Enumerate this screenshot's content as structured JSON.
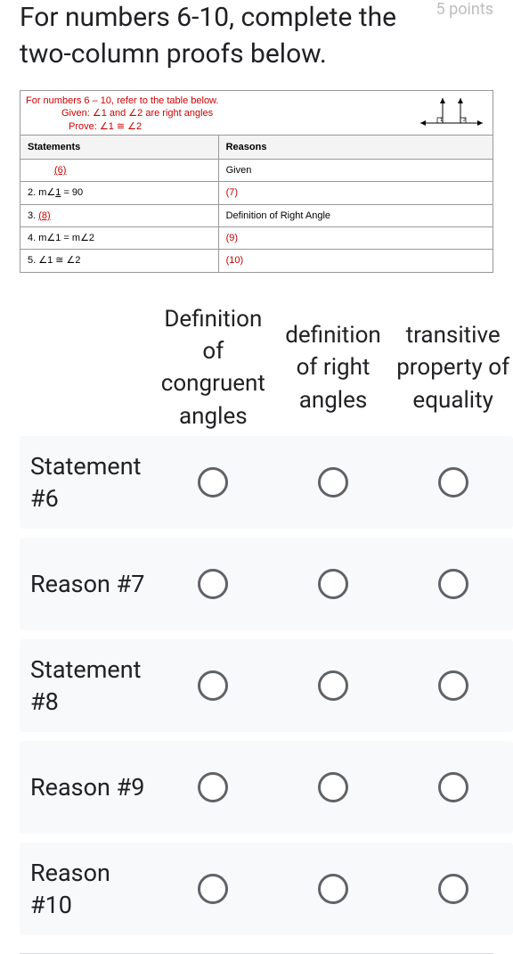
{
  "header": {
    "title": "For numbers 6-10, complete the two-column proofs below.",
    "points": "5 points"
  },
  "diagram": {
    "intro": "For numbers 6 – 10, refer to the table below.",
    "given": "Given: ∠1 and ∠2 are right angles",
    "prove": "Prove: ∠1 ≅ ∠2",
    "headers": {
      "statements": "Statements",
      "reasons": "Reasons"
    },
    "rows": [
      {
        "st_prefix": "",
        "st_blank": "(6)",
        "rs": "Given",
        "rs_red": false
      },
      {
        "st_prefix": "2. m∠1 = 90",
        "st_blank": "",
        "rs": "(7)",
        "rs_red": true,
        "underline_st": true
      },
      {
        "st_prefix": "3. ",
        "st_blank": "(8)",
        "rs": "Definition of Right Angle",
        "rs_red": false
      },
      {
        "st_prefix": "4. m∠1 = m∠2",
        "st_blank": "",
        "rs": "(9)",
        "rs_red": true
      },
      {
        "st_prefix": "5. ∠1 ≅ ∠2",
        "st_blank": "",
        "rs": "(10)",
        "rs_red": true
      }
    ]
  },
  "matrix": {
    "columns": [
      "Definition of congruent angles",
      "definition of right angles",
      "transitive property of equality"
    ],
    "rows": [
      {
        "label": "Statement #6"
      },
      {
        "label": "Reason #7"
      },
      {
        "label": "Statement #8"
      },
      {
        "label": "Reason #9"
      },
      {
        "label": "Reason #10"
      }
    ]
  }
}
